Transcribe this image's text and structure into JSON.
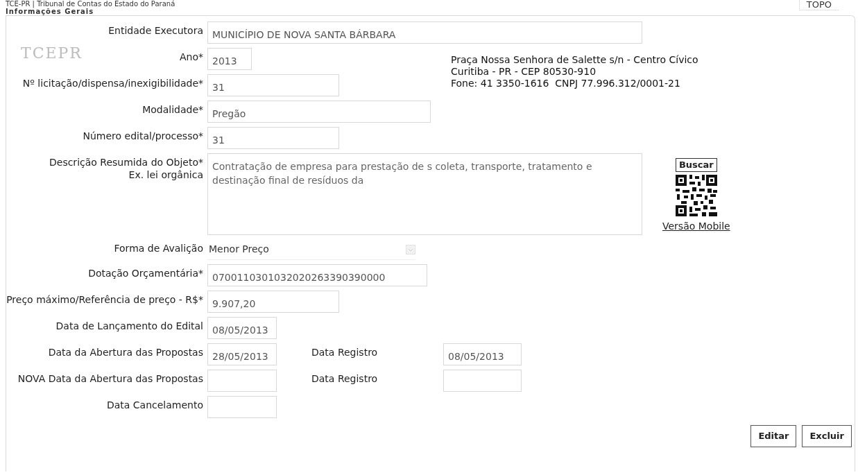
{
  "header": {
    "title": "TCE-PR | Tribunal de Contas do Estado do Paraná",
    "top_link": "TOPO",
    "logo": "TCEPR",
    "address": [
      "Praça Nossa Senhora de Salette s/n - Centro Cívico",
      "Curitiba - PR - CEP 80530-910",
      "Fone: 41 3350-1616  CNPJ 77.996.312/0001-21"
    ],
    "search_button": "Buscar",
    "mobile_link": "Versão Mobile"
  },
  "section_title": "Informações Gerais",
  "fields": [
    {
      "kind": "input",
      "label": "Entidade Executora",
      "value": "MUNICÍPIO DE NOVA SANTA BÁRBARA"
    },
    {
      "kind": "input",
      "label": "Ano*",
      "value": "2013"
    },
    {
      "kind": "input",
      "label": "Nº licitação/dispensa/inexigibilidade*",
      "value": "31"
    },
    {
      "kind": "input",
      "label": "Modalidade*",
      "value": "Pregão"
    },
    {
      "kind": "input",
      "label": "Número edital/processo*",
      "value": "31"
    },
    {
      "kind": "textarea",
      "label": "Descrição Resumida do Objeto*",
      "hint": "Ex. lei orgânica",
      "value": "Contratação de empresa para prestação de s coleta, transporte, tratamento e destinação final de resíduos da"
    },
    {
      "kind": "select",
      "label": "Forma de Avalição",
      "value": "Menor Preço"
    },
    {
      "kind": "input",
      "label": "Dotação Orçamentária*",
      "value": "0700110301032020263390390000"
    },
    {
      "kind": "input",
      "label": "Preço máximo/Referência de preço - R$*",
      "value": "9.907,20"
    },
    {
      "kind": "date",
      "label": "Data de Lançamento do Edital",
      "value": "08/05/2013"
    },
    {
      "kind": "date",
      "label": "Data da Abertura das Propostas",
      "value": "28/05/2013",
      "side": {
        "label": "Data Registro",
        "value": "08/05/2013"
      }
    },
    {
      "kind": "date",
      "label": "NOVA Data da Abertura das Propostas",
      "side": {
        "label": "Data Registro"
      }
    },
    {
      "kind": "date",
      "label": "Data Cancelamento"
    }
  ],
  "buttons": [
    "Editar",
    "Excluir"
  ]
}
